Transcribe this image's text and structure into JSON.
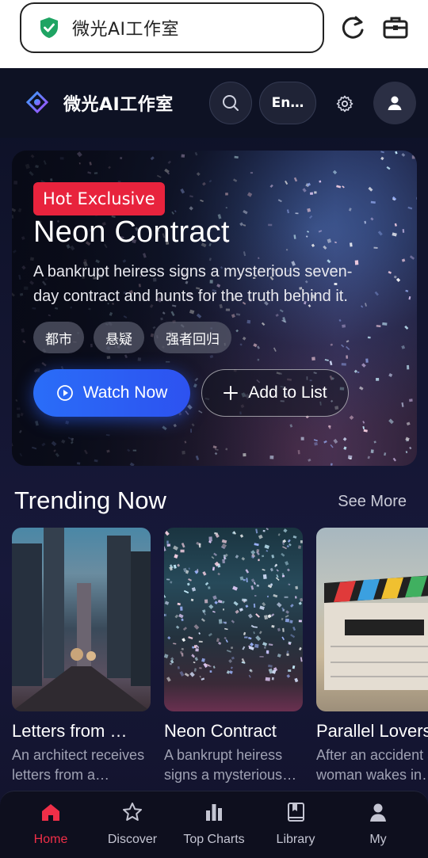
{
  "browser": {
    "url_text": "微光AI工作室",
    "icons": [
      "shield-check-icon",
      "reload-icon",
      "toolbox-icon"
    ]
  },
  "header": {
    "brand": "微光AI工作室",
    "language_label": "En…",
    "icons": [
      "logo-icon",
      "search-icon",
      "gear-icon",
      "user-icon"
    ]
  },
  "hero": {
    "badge": "Hot Exclusive",
    "title": "Neon Contract",
    "description": "A bankrupt heiress signs a mysterious seven-day contract and hunts for the truth behind it.",
    "tags": [
      "都市",
      "悬疑",
      "强者回归"
    ],
    "watch_label": "Watch Now",
    "add_label": "Add to List"
  },
  "trending": {
    "title": "Trending Now",
    "see_more": "See More",
    "items": [
      {
        "title": "Letters from …",
        "desc": "An architect receives letters from a stranger",
        "poster": "city-street"
      },
      {
        "title": "Neon Contract",
        "desc": "A bankrupt heiress signs a mysterious contract",
        "poster": "concert-confetti"
      },
      {
        "title": "Parallel Lovers",
        "desc": "After an accident a woman wakes in another life",
        "poster": "film-clapperboard"
      }
    ]
  },
  "nav": {
    "items": [
      {
        "label": "Home",
        "icon": "home-icon",
        "active": true
      },
      {
        "label": "Discover",
        "icon": "star-icon",
        "active": false
      },
      {
        "label": "Top Charts",
        "icon": "bar-chart-icon",
        "active": false
      },
      {
        "label": "Library",
        "icon": "book-icon",
        "active": false
      },
      {
        "label": "My",
        "icon": "person-icon",
        "active": false
      }
    ]
  },
  "colors": {
    "accent_red": "#e8233d",
    "accent_blue": "#2a6df8",
    "background": "#0b0d1c"
  }
}
